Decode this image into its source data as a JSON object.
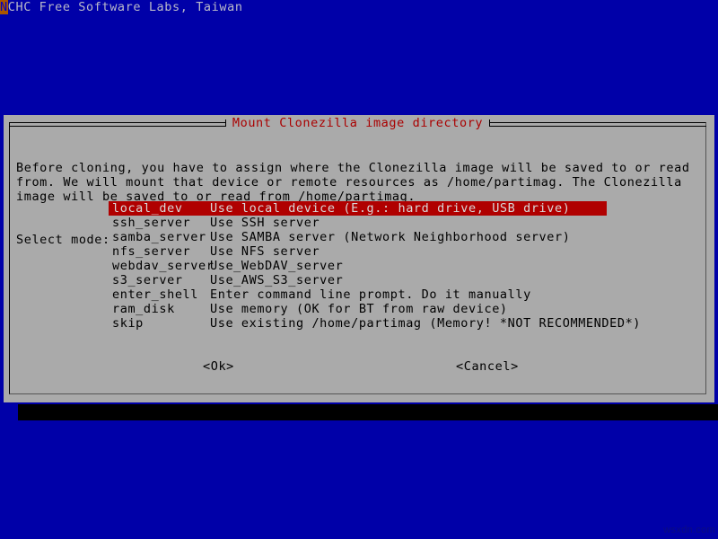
{
  "console": {
    "cursor_char": "N",
    "line_rest": "CHC Free Software Labs, Taiwan",
    "cursor_bg": "#aa5500"
  },
  "dialog": {
    "title": "Mount Clonezilla image directory",
    "title_color": "#aa0000",
    "background": "#aaaaaa",
    "body_paragraph": "Before cloning, you have to assign where the Clonezilla image will be saved to or read from. We will mount that device or remote resources as /home/partimag. The Clonezilla image will be saved to or read from /home/partimag.",
    "select_label": "Select mode:",
    "selection_color": "#b00000",
    "menu": [
      {
        "tag": "local_dev",
        "desc": "Use local device (E.g.: hard drive, USB drive)",
        "selected": true
      },
      {
        "tag": "ssh_server",
        "desc": "Use SSH server",
        "selected": false
      },
      {
        "tag": "samba_server",
        "desc": "Use SAMBA server (Network Neighborhood server)",
        "selected": false
      },
      {
        "tag": "nfs_server",
        "desc": "Use NFS server",
        "selected": false
      },
      {
        "tag": "webdav_server",
        "desc": "Use_WebDAV_server",
        "selected": false
      },
      {
        "tag": "s3_server",
        "desc": "Use_AWS_S3_server",
        "selected": false
      },
      {
        "tag": "enter_shell",
        "desc": "Enter command line prompt. Do it manually",
        "selected": false
      },
      {
        "tag": "ram_disk",
        "desc": "Use memory (OK for BT from raw device)",
        "selected": false
      },
      {
        "tag": "skip",
        "desc": "Use existing /home/partimag (Memory! *NOT RECOMMENDED*)",
        "selected": false
      }
    ],
    "buttons": {
      "ok": "<Ok>",
      "cancel": "<Cancel>"
    }
  },
  "watermark": "wsxdn.com",
  "background_color": "#0000a8"
}
